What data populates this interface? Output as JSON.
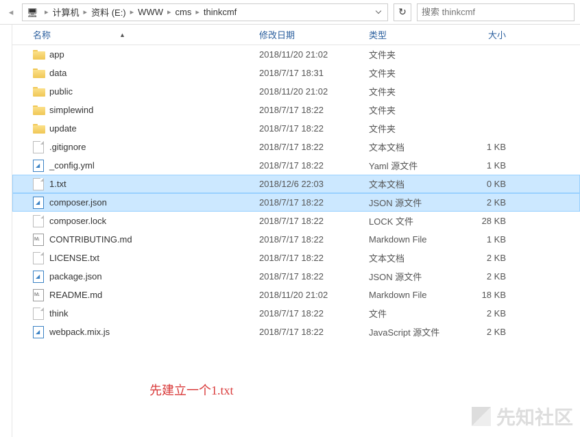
{
  "breadcrumb": {
    "items": [
      "计算机",
      "资料 (E:)",
      "WWW",
      "cms",
      "thinkcmf"
    ]
  },
  "search": {
    "placeholder": "搜索 thinkcmf"
  },
  "columns": {
    "name": "名称",
    "date": "修改日期",
    "type": "类型",
    "size": "大小"
  },
  "files": [
    {
      "icon": "folder",
      "name": "app",
      "date": "2018/11/20 21:02",
      "type": "文件夹",
      "size": "",
      "selected": false
    },
    {
      "icon": "folder",
      "name": "data",
      "date": "2018/7/17 18:31",
      "type": "文件夹",
      "size": "",
      "selected": false
    },
    {
      "icon": "folder",
      "name": "public",
      "date": "2018/11/20 21:02",
      "type": "文件夹",
      "size": "",
      "selected": false
    },
    {
      "icon": "folder",
      "name": "simplewind",
      "date": "2018/7/17 18:22",
      "type": "文件夹",
      "size": "",
      "selected": false
    },
    {
      "icon": "folder",
      "name": "update",
      "date": "2018/7/17 18:22",
      "type": "文件夹",
      "size": "",
      "selected": false
    },
    {
      "icon": "file",
      "name": ".gitignore",
      "date": "2018/7/17 18:22",
      "type": "文本文档",
      "size": "1 KB",
      "selected": false
    },
    {
      "icon": "code",
      "name": "_config.yml",
      "date": "2018/7/17 18:22",
      "type": "Yaml 源文件",
      "size": "1 KB",
      "selected": false
    },
    {
      "icon": "file",
      "name": "1.txt",
      "date": "2018/12/6 22:03",
      "type": "文本文档",
      "size": "0 KB",
      "selected": true
    },
    {
      "icon": "code",
      "name": "composer.json",
      "date": "2018/7/17 18:22",
      "type": "JSON 源文件",
      "size": "2 KB",
      "selected": true
    },
    {
      "icon": "file",
      "name": "composer.lock",
      "date": "2018/7/17 18:22",
      "type": "LOCK 文件",
      "size": "28 KB",
      "selected": false
    },
    {
      "icon": "md",
      "name": "CONTRIBUTING.md",
      "date": "2018/7/17 18:22",
      "type": "Markdown File",
      "size": "1 KB",
      "selected": false
    },
    {
      "icon": "file",
      "name": "LICENSE.txt",
      "date": "2018/7/17 18:22",
      "type": "文本文档",
      "size": "2 KB",
      "selected": false
    },
    {
      "icon": "code",
      "name": "package.json",
      "date": "2018/7/17 18:22",
      "type": "JSON 源文件",
      "size": "2 KB",
      "selected": false
    },
    {
      "icon": "md",
      "name": "README.md",
      "date": "2018/11/20 21:02",
      "type": "Markdown File",
      "size": "18 KB",
      "selected": false
    },
    {
      "icon": "file",
      "name": "think",
      "date": "2018/7/17 18:22",
      "type": "文件",
      "size": "2 KB",
      "selected": false
    },
    {
      "icon": "code",
      "name": "webpack.mix.js",
      "date": "2018/7/17 18:22",
      "type": "JavaScript 源文件",
      "size": "2 KB",
      "selected": false
    }
  ],
  "annotation": "先建立一个1.txt",
  "watermark": "先知社区"
}
